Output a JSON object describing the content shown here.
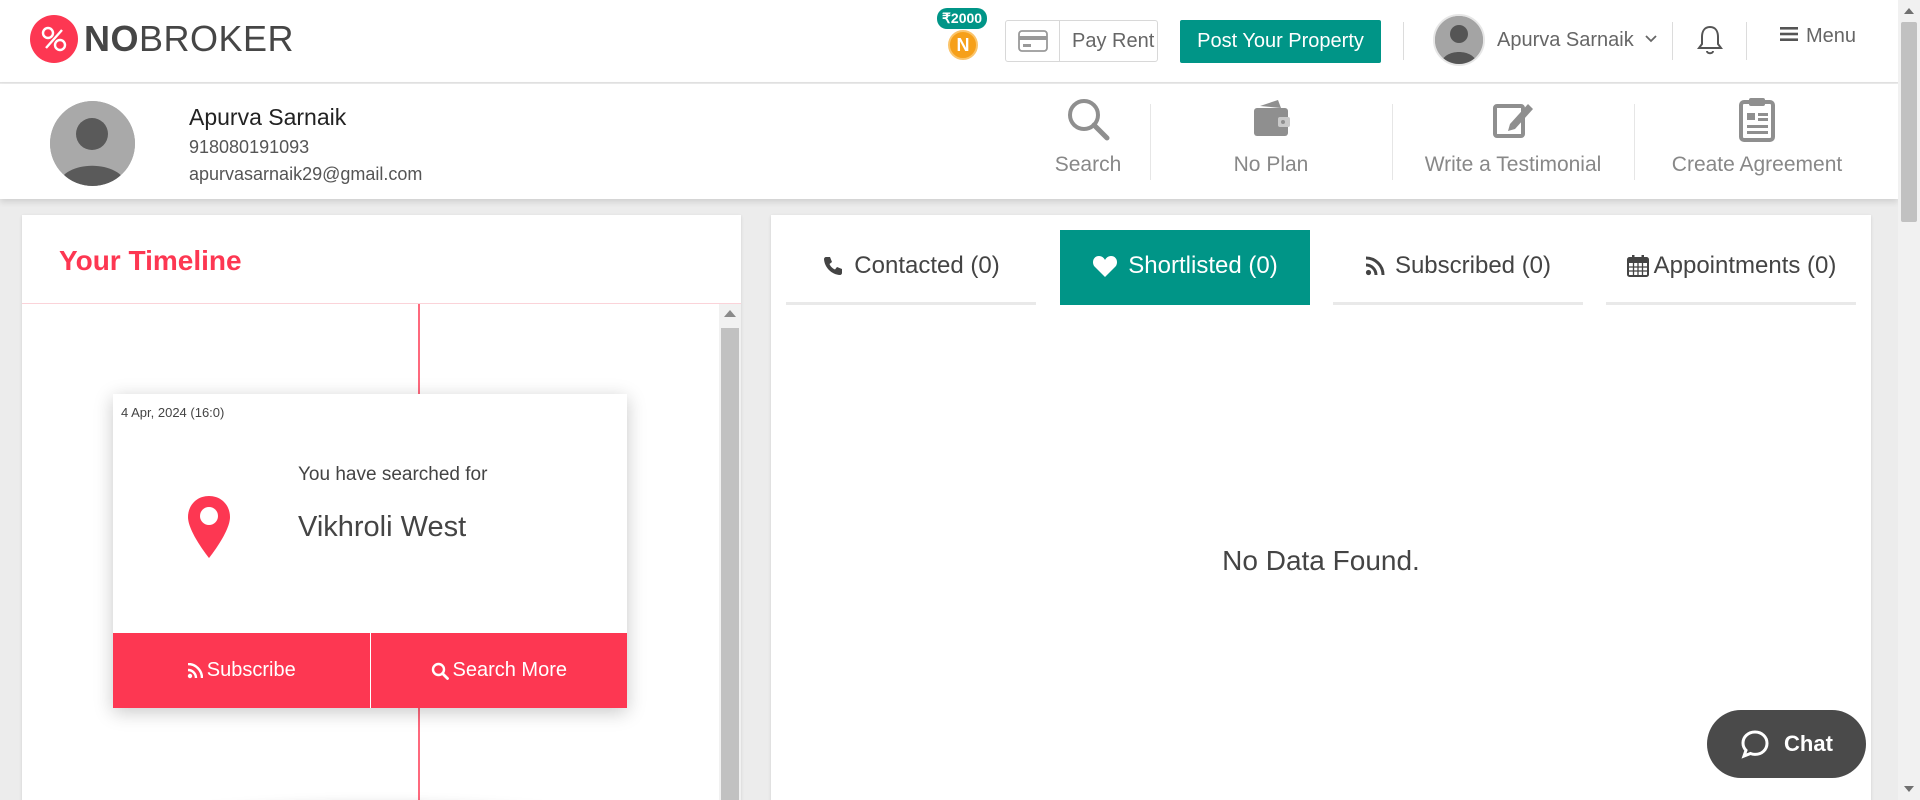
{
  "header": {
    "logo_bold": "NO",
    "logo_rest": "BROKER",
    "coin_balance": "₹2000",
    "coin_letter": "N",
    "pay_rent_label": "Pay Rent",
    "post_property_label": "Post Your Property",
    "user_name": "Apurva Sarnaik",
    "menu_label": "Menu"
  },
  "profile": {
    "name": "Apurva Sarnaik",
    "phone": "918080191093",
    "email": "apurvasarnaik29@gmail.com",
    "actions": [
      {
        "label": "Search",
        "icon": "search-icon"
      },
      {
        "label": "No Plan",
        "icon": "wallet-icon"
      },
      {
        "label": "Write a Testimonial",
        "icon": "edit-icon"
      },
      {
        "label": "Create Agreement",
        "icon": "clipboard-icon"
      }
    ]
  },
  "timeline": {
    "title": "Your Timeline",
    "card": {
      "date": "4 Apr, 2024 (16:0)",
      "searched_text": "You have searched for",
      "place": "Vikhroli West",
      "subscribe_label": "Subscribe",
      "search_more_label": "Search More"
    }
  },
  "tabs": [
    {
      "label": "Contacted (0)",
      "icon": "phone-icon",
      "active": false
    },
    {
      "label": "Shortlisted (0)",
      "icon": "heart-icon",
      "active": true
    },
    {
      "label": "Subscribed (0)",
      "icon": "rss-icon",
      "active": false
    },
    {
      "label": "Appointments (0)",
      "icon": "calendar-icon",
      "active": false
    }
  ],
  "content": {
    "empty_message": "No Data Found."
  },
  "chat": {
    "label": "Chat"
  },
  "colors": {
    "brand_red": "#fd3752",
    "brand_teal": "#009587",
    "coin_orange": "#f6a01a"
  }
}
